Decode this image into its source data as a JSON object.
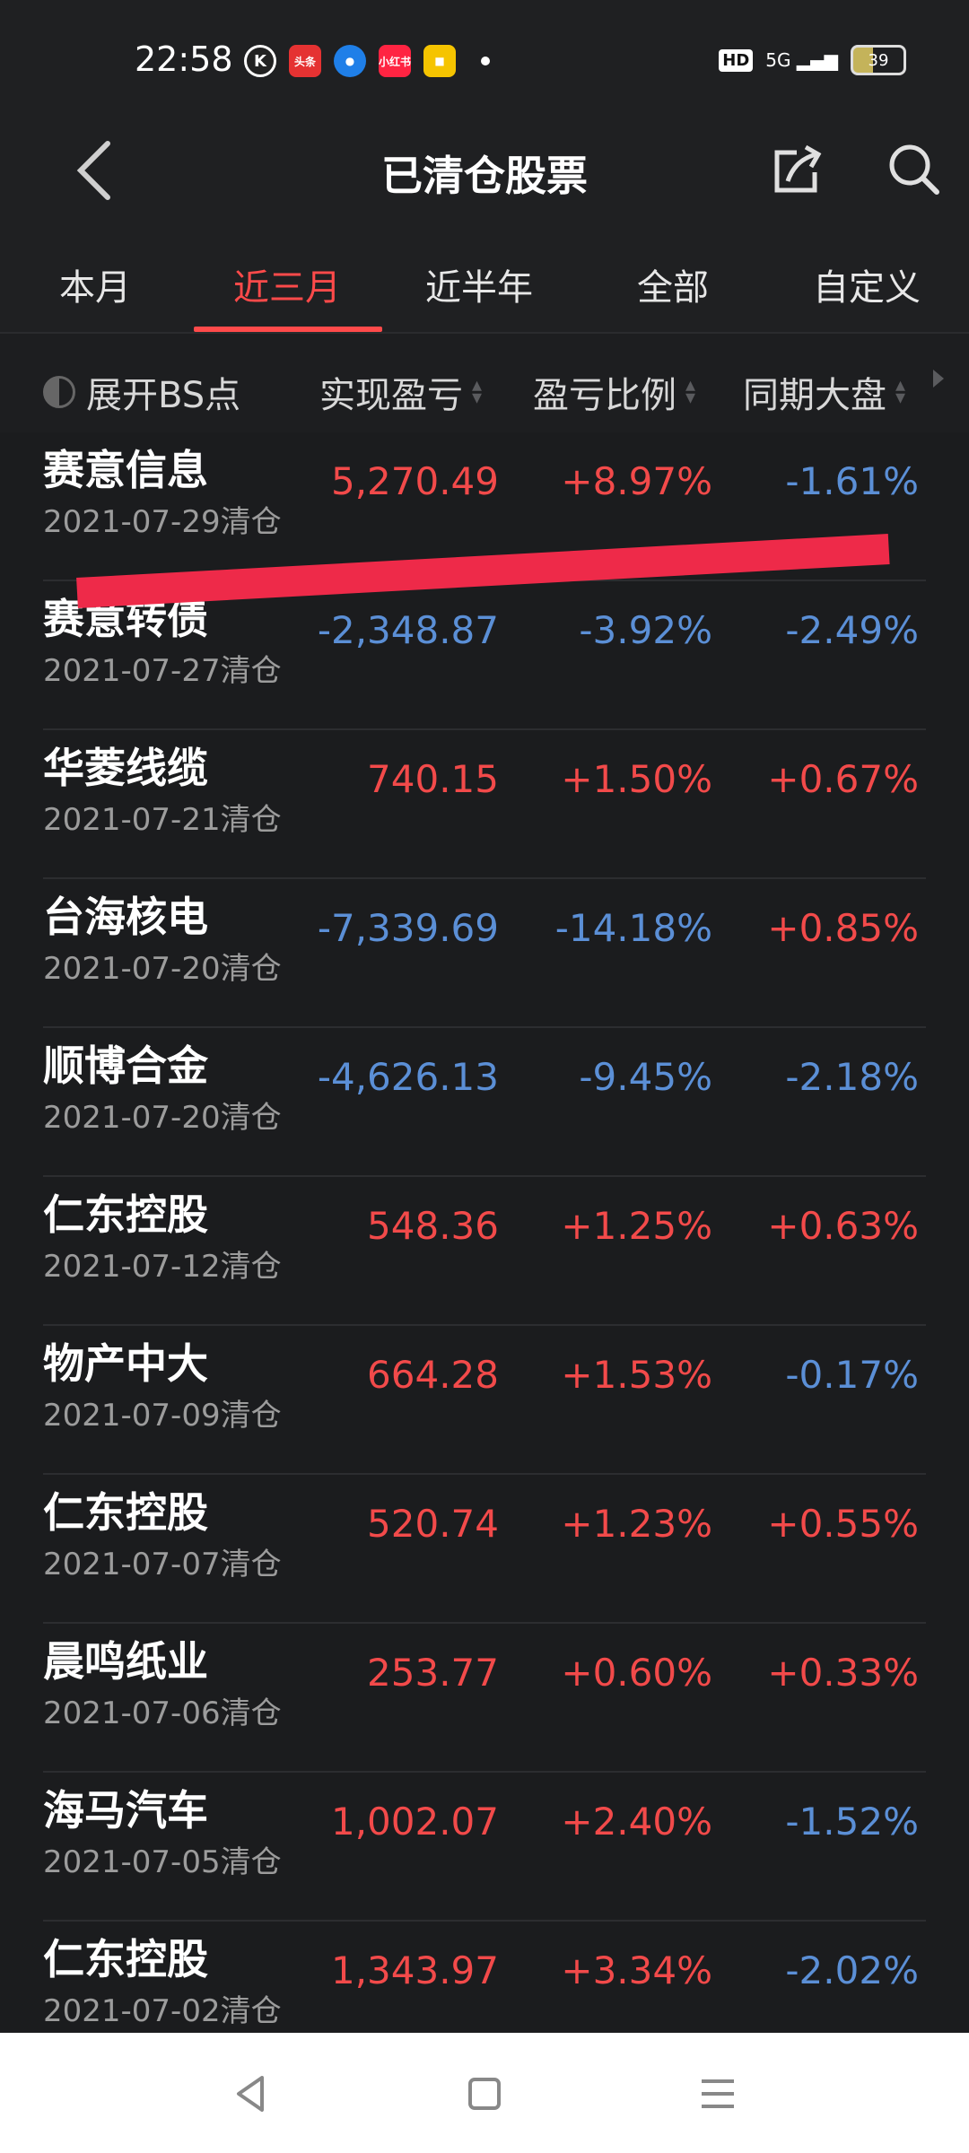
{
  "status_bar": {
    "time": "22:58",
    "app_icons": [
      "K",
      "头条",
      "",
      "小红书",
      ""
    ],
    "network": "HD",
    "signal_label": "5G",
    "battery": "39"
  },
  "header": {
    "title": "已清仓股票"
  },
  "tabs": [
    {
      "label": "本月"
    },
    {
      "label": "近三月"
    },
    {
      "label": "近半年"
    },
    {
      "label": "全部"
    },
    {
      "label": "自定义"
    }
  ],
  "columns": {
    "expand_bs": "展开BS点",
    "realized_pnl": "实现盈亏",
    "pnl_ratio": "盈亏比例",
    "market_same_period": "同期大盘"
  },
  "rows": [
    {
      "name": "赛意信息",
      "date": "2021-07-29清仓",
      "pnl": "5,270.49",
      "ratio": "+8.97%",
      "market": "-1.61%"
    },
    {
      "name": "赛意转债",
      "date": "2021-07-27清仓",
      "pnl": "-2,348.87",
      "ratio": "-3.92%",
      "market": "-2.49%"
    },
    {
      "name": "华菱线缆",
      "date": "2021-07-21清仓",
      "pnl": "740.15",
      "ratio": "+1.50%",
      "market": "+0.67%"
    },
    {
      "name": "台海核电",
      "date": "2021-07-20清仓",
      "pnl": "-7,339.69",
      "ratio": "-14.18%",
      "market": "+0.85%"
    },
    {
      "name": "顺博合金",
      "date": "2021-07-20清仓",
      "pnl": "-4,626.13",
      "ratio": "-9.45%",
      "market": "-2.18%"
    },
    {
      "name": "仁东控股",
      "date": "2021-07-12清仓",
      "pnl": "548.36",
      "ratio": "+1.25%",
      "market": "+0.63%"
    },
    {
      "name": "物产中大",
      "date": "2021-07-09清仓",
      "pnl": "664.28",
      "ratio": "+1.53%",
      "market": "-0.17%"
    },
    {
      "name": "仁东控股",
      "date": "2021-07-07清仓",
      "pnl": "520.74",
      "ratio": "+1.23%",
      "market": "+0.55%"
    },
    {
      "name": "晨鸣纸业",
      "date": "2021-07-06清仓",
      "pnl": "253.77",
      "ratio": "+0.60%",
      "market": "+0.33%"
    },
    {
      "name": "海马汽车",
      "date": "2021-07-05清仓",
      "pnl": "1,002.07",
      "ratio": "+2.40%",
      "market": "-1.52%"
    },
    {
      "name": "仁东控股",
      "date": "2021-07-02清仓",
      "pnl": "1,343.97",
      "ratio": "+3.34%",
      "market": "-2.02%"
    }
  ],
  "colors": {
    "positive": "#f24a4a",
    "negative": "#5b8fd6",
    "active_tab": "#ff4a4a",
    "background": "#1b1c1e"
  },
  "icons": {
    "back": "chevron-left-icon",
    "share": "share-icon",
    "search": "search-icon",
    "nav_back": "triangle-back-icon",
    "nav_home": "square-home-icon",
    "nav_menu": "menu-lines-icon"
  }
}
